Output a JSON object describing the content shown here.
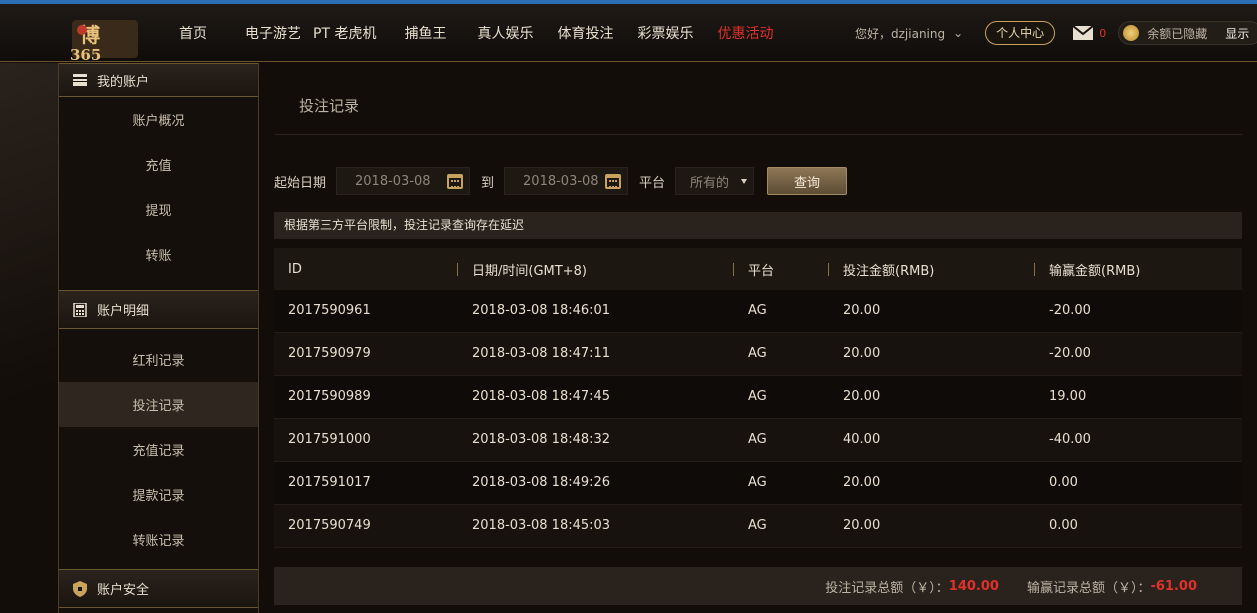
{
  "header": {
    "nav": [
      "首页",
      "电子游艺",
      "PT 老虎机",
      "捕鱼王",
      "真人娱乐",
      "体育投注",
      "彩票娱乐",
      "优惠活动"
    ],
    "greeting": "您好，dzjianing",
    "center_label": "个人中心",
    "mail_count": "0",
    "balance_text": "余额已隐藏",
    "show_label": "显示"
  },
  "sidebar": {
    "sections": [
      {
        "title": "我的账户",
        "icon": "card-icon",
        "items": [
          "账户概况",
          "充值",
          "提现",
          "转账"
        ]
      },
      {
        "title": "账户明细",
        "icon": "calculator-icon",
        "items": [
          "红利记录",
          "投注记录",
          "充值记录",
          "提款记录",
          "转账记录"
        ]
      },
      {
        "title": "账户安全",
        "icon": "shield-icon",
        "items": []
      }
    ],
    "active": "投注记录"
  },
  "main": {
    "title": "投注记录",
    "filters": {
      "start_label": "起始日期",
      "start_value": "2018-03-08",
      "to_label": "到",
      "end_value": "2018-03-08",
      "platform_label": "平台",
      "platform_value": "所有的",
      "query_label": "查询"
    },
    "notice": "根据第三方平台限制，投注记录查询存在延迟",
    "table": {
      "headers": [
        "ID",
        "日期/时间(GMT+8)",
        "平台",
        "投注金额(RMB)",
        "输赢金额(RMB)"
      ],
      "rows": [
        [
          "2017590961",
          "2018-03-08 18:46:01",
          "AG",
          "20.00",
          "-20.00"
        ],
        [
          "2017590979",
          "2018-03-08 18:47:11",
          "AG",
          "20.00",
          "-20.00"
        ],
        [
          "2017590989",
          "2018-03-08 18:47:45",
          "AG",
          "20.00",
          "19.00"
        ],
        [
          "2017591000",
          "2018-03-08 18:48:32",
          "AG",
          "40.00",
          "-40.00"
        ],
        [
          "2017591017",
          "2018-03-08 18:49:26",
          "AG",
          "20.00",
          "0.00"
        ],
        [
          "2017590749",
          "2018-03-08 18:45:03",
          "AG",
          "20.00",
          "0.00"
        ]
      ]
    },
    "summary": {
      "bet_label": "投注记录总额（￥）：",
      "bet_value": "140.00",
      "win_label": "输赢记录总额（￥）：",
      "win_value": "-61.00"
    }
  },
  "colors": {
    "accent_gold": "#c9a35b",
    "promo_red": "#e0312a",
    "top_border_blue": "#2a6fb3"
  }
}
